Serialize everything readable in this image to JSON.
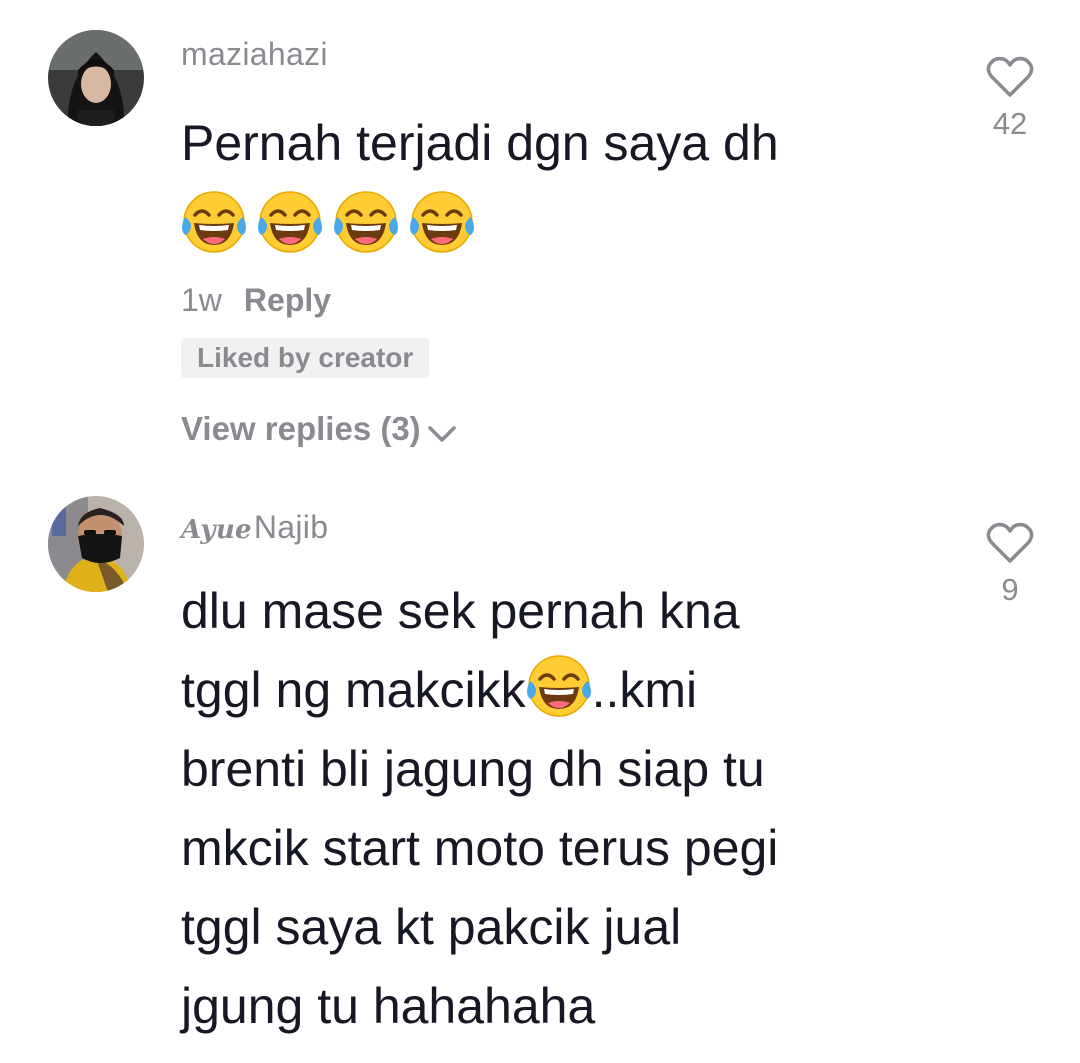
{
  "comments": [
    {
      "username": "maziahazi",
      "text": "Pernah terjadi dgn saya dh",
      "emojis": [
        "tears-of-joy",
        "tears-of-joy",
        "tears-of-joy",
        "tears-of-joy"
      ],
      "time": "1w",
      "reply_label": "Reply",
      "badge": "Liked by creator",
      "view_replies": "View replies (3)",
      "likes": "42",
      "like_icon": "heart-outline-icon"
    },
    {
      "username_script": "Ayue",
      "username": "Najib",
      "text_line1": "dlu mase sek pernah kna",
      "text_line2a": "tggl ng makcikk",
      "text_line2b": "..kmi",
      "text_rest": "brenti bli jagung dh siap tu\nmkcik start moto terus pegi\ntggl saya kt pakcik jual\njgung tu hahahaha",
      "likes": "9",
      "like_icon": "heart-outline-icon"
    }
  ],
  "colors": {
    "text": "#161823",
    "muted": "#8a8b91",
    "badge_bg": "#f1f1f2",
    "emoji_face": "#ffcc33",
    "emoji_tear": "#4aa8e8"
  }
}
